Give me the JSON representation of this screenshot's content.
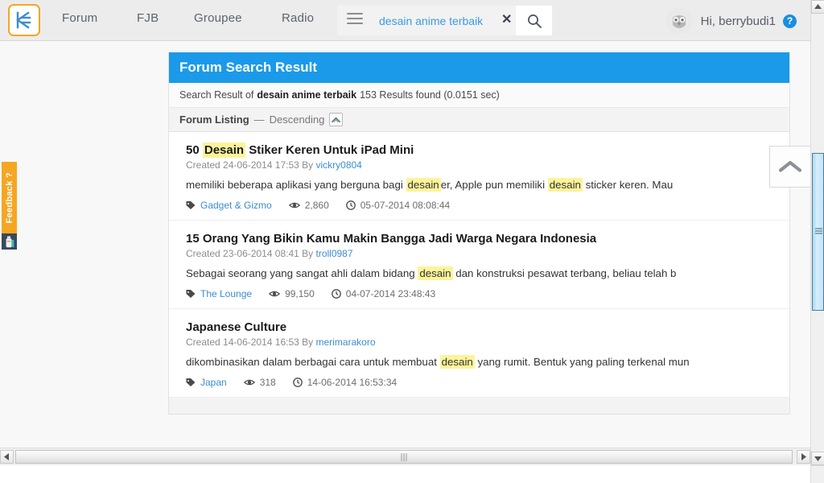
{
  "header": {
    "logo_alt": "kaskus-logo",
    "nav": [
      {
        "label": "Forum"
      },
      {
        "label": "FJB"
      },
      {
        "label": "Groupee"
      },
      {
        "label": "Radio"
      }
    ],
    "search": {
      "value": "desain anime terbaik",
      "placeholder": "desain anime terbaik",
      "menu_icon": "hamburger-icon",
      "clear_icon": "clear-x-icon",
      "mic_icon": "microphone-icon",
      "submit_icon": "search-icon"
    },
    "user": {
      "greeting": "Hi, berrybudi1",
      "avatar_icon": "owl-avatar-icon",
      "help_label": "?"
    }
  },
  "feedback": {
    "label": "Feedback ?",
    "icon": "feedback-bottle-icon"
  },
  "panel": {
    "title": "Forum Search Result",
    "result_info": {
      "prefix": "Search Result of",
      "query": "desain anime terbaik",
      "suffix": "153 Results found (0.0151 sec)"
    },
    "listing": {
      "label": "Forum Listing",
      "dash": "—",
      "order": "Descending",
      "sort_icon": "chevron-up-icon"
    }
  },
  "results": [
    {
      "title_parts": [
        {
          "text": "50 ",
          "highlight": false
        },
        {
          "text": "Desain",
          "highlight": true
        },
        {
          "text": " Stiker Keren Untuk iPad Mini",
          "highlight": false
        }
      ],
      "title_plain": "50 Desain Stiker Keren Untuk iPad Mini",
      "created_label": "Created",
      "created_date": "24-06-2014 17:53",
      "by_label": "By",
      "author": "vickry0804",
      "snippet_parts": [
        {
          "text": "memiliki beberapa aplikasi yang berguna bagi ",
          "highlight": false
        },
        {
          "text": "desain",
          "highlight": true
        },
        {
          "text": "er, Apple pun memiliki ",
          "highlight": false
        },
        {
          "text": "desain",
          "highlight": true
        },
        {
          "text": " sticker keren. Mau",
          "highlight": false
        }
      ],
      "category": "Gadget & Gizmo",
      "views": "2,860",
      "timestamp": "05-07-2014 08:08:44"
    },
    {
      "title_parts": [
        {
          "text": "15 Orang Yang Bikin Kamu Makin Bangga Jadi Warga Negara Indonesia",
          "highlight": false
        }
      ],
      "title_plain": "15 Orang Yang Bikin Kamu Makin Bangga Jadi Warga Negara Indonesia",
      "created_label": "Created",
      "created_date": "23-06-2014 08:41",
      "by_label": "By",
      "author": "troll0987",
      "snippet_parts": [
        {
          "text": "Sebagai seorang yang sangat ahli dalam bidang ",
          "highlight": false
        },
        {
          "text": "desain",
          "highlight": true
        },
        {
          "text": " dan konstruksi pesawat terbang, beliau telah b",
          "highlight": false
        }
      ],
      "category": "The Lounge",
      "views": "99,150",
      "timestamp": "04-07-2014 23:48:43"
    },
    {
      "title_parts": [
        {
          "text": "Japanese Culture",
          "highlight": false
        }
      ],
      "title_plain": "Japanese Culture",
      "created_label": "Created",
      "created_date": "14-06-2014 16:53",
      "by_label": "By",
      "author": "merimarakoro",
      "snippet_parts": [
        {
          "text": "dikombinasikan dalam berbagai cara untuk membuat ",
          "highlight": false
        },
        {
          "text": "desain",
          "highlight": true
        },
        {
          "text": " yang rumit. Bentuk yang paling terkenal mun",
          "highlight": false
        }
      ],
      "category": "Japan",
      "views": "318",
      "timestamp": "14-06-2014 16:53:34"
    }
  ],
  "scroll_top": {
    "icon": "chevron-up-icon"
  },
  "colors": {
    "brand_blue": "#1a9ae8",
    "accent_orange": "#f5a623",
    "link_blue": "#3b8dd0",
    "highlight_yellow": "#fcf49a",
    "header_bg": "#ececec"
  },
  "scrollbars": {
    "vertical_up_icon": "triangle-up-icon",
    "vertical_down_icon": "triangle-down-icon",
    "horizontal_left_icon": "triangle-left-icon",
    "horizontal_right_icon": "triangle-right-icon"
  }
}
